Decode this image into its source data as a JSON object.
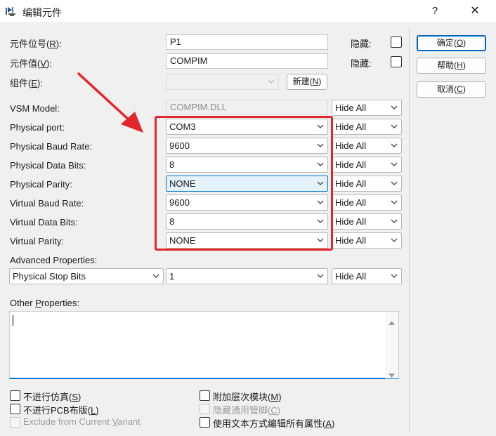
{
  "window": {
    "title": "编辑元件",
    "help": "?",
    "close": "✕"
  },
  "fields": {
    "ref_label": "元件位号(",
    "ref_key": "R",
    "ref_tail": "):",
    "ref_value": "P1",
    "val_label": "元件值(",
    "val_key": "V",
    "val_tail": "):",
    "val_value": "COMPIM",
    "grp_label": "组件(",
    "grp_key": "E",
    "grp_tail": "):",
    "hidden_label": "隐藏:",
    "new_button": "新建(",
    "new_key": "N",
    "new_tail": ")"
  },
  "properties": [
    {
      "label": "VSM Model:",
      "value": "COMPIM.DLL",
      "visibility": "Hide All"
    },
    {
      "label": "Physical port:",
      "value": "COM3",
      "visibility": "Hide All"
    },
    {
      "label": "Physical Baud Rate:",
      "value": "9600",
      "visibility": "Hide All"
    },
    {
      "label": "Physical Data Bits:",
      "value": "8",
      "visibility": "Hide All"
    },
    {
      "label": "Physical Parity:",
      "value": "NONE",
      "visibility": "Hide All"
    },
    {
      "label": "Virtual Baud Rate:",
      "value": "9600",
      "visibility": "Hide All"
    },
    {
      "label": "Virtual Data Bits:",
      "value": "8",
      "visibility": "Hide All"
    },
    {
      "label": "Virtual Parity:",
      "value": "NONE",
      "visibility": "Hide All"
    }
  ],
  "advanced": {
    "label": "Advanced Properties:",
    "property": "Physical Stop Bits",
    "value": "1",
    "visibility": "Hide All"
  },
  "other": {
    "label_pre": "Other ",
    "label_key": "P",
    "label_post": "roperties:"
  },
  "options_left": [
    {
      "pre": "不进行仿真(",
      "key": "S",
      "post": ")",
      "enabled": true
    },
    {
      "pre": "不进行PCB布版(",
      "key": "L",
      "post": ")",
      "enabled": true
    },
    {
      "pre": "Exclude from Current ",
      "key": "V",
      "post": "ariant",
      "enabled": false
    }
  ],
  "options_right": [
    {
      "pre": "附加层次模块(",
      "key": "M",
      "post": ")",
      "enabled": true
    },
    {
      "pre": "隐藏通用管脚(",
      "key": "C",
      "post": ")",
      "enabled": false
    },
    {
      "pre": "使用文本方式编辑所有属性(",
      "key": "A",
      "post": ")",
      "enabled": true
    }
  ],
  "buttons": [
    {
      "pre": "确定(",
      "key": "O",
      "post": ")"
    },
    {
      "pre": "帮助(",
      "key": "H",
      "post": ")"
    },
    {
      "pre": "取消(",
      "key": "C",
      "post": ")"
    }
  ],
  "colors": {
    "annotation": "#e3262b",
    "focus": "#0078d7"
  },
  "icons": {
    "app": "diode-icon",
    "dropdown": "chevron-down-icon"
  }
}
